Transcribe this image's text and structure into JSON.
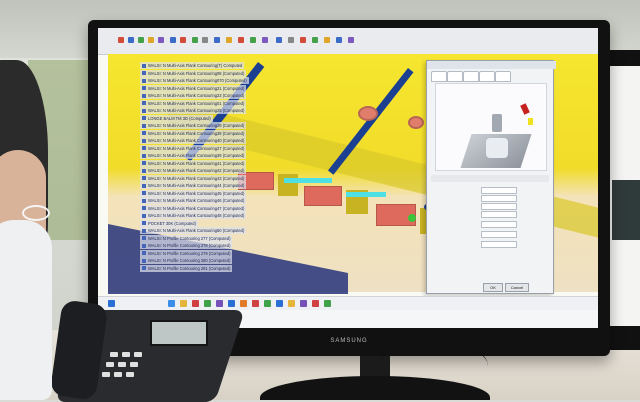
{
  "monitor": {
    "brand_label": "SAMSUNG"
  },
  "phone": {
    "brand_label": ""
  },
  "cad": {
    "menubar_text": "",
    "tree_rows": [
      "WALSI: N Multi-Axis Flank Contouring(T) Computed",
      "WALSI: N Multi-Axis Flank Contouring08 (Computed)",
      "WALSI: N Multi-Axis Flank Contouring070 (Computed)",
      "WALSI: N Multi-Axis Flank Contouring21 (Computed)",
      "WALSI: N Multi-Axis Flank Contouring23 (Computed)",
      "WALSI: N Multi-Axis Flank Contouring01 (Computed)",
      "WALSI: N Multi-Axis Flank Contouring25 (Computed)",
      "LONGE BALM TM 3D (Computed)",
      "WALSI: N Multi-Axis Flank Contouring28 (Computed)",
      "WALSI: N Multi-Axis Flank Contouring38 (Computed)",
      "WALSI: N Multi-Axis Flank Contouring40 (Computed)",
      "WALSI: N Multi-Axis Flank Contouring27 (Computed)",
      "WALSI: N Multi-Axis Flank Contouring39 (Computed)",
      "WALSI: N Multi-Axis Flank Contouring41 (Computed)",
      "WALSI: N Multi-Axis Flank Contouring42 (Computed)",
      "WALSI: N Multi-Axis Flank Contouring43 (Computed)",
      "WALSI: N Multi-Axis Flank Contouring44 (Computed)",
      "WALSI: N Multi-Axis Flank Contouring45 (Computed)",
      "WALSI: N Multi-Axis Flank Contouring46 (Computed)",
      "WALSI: N Multi-Axis Flank Contouring47 (Computed)",
      "WALSI: N Multi-Axis Flank Contouring48 (Computed)",
      "POCKET 30K (Computed)",
      "WALSI: N Multi-Axis Flank Contouring50 (Computed)",
      "WALSI: N Profile Contouring 277 (Computed)",
      "WALSI: N Profile Contouring 278 (Computed)",
      "WALSI: N Profile Contouring 279 (Computed)",
      "WALSI: N Profile Contouring 280 (Computed)",
      "WALSI: N Profile Contouring 281 (Computed)"
    ],
    "dialog": {
      "title": "",
      "param_labels": [
        "",
        "",
        "",
        "",
        "",
        "",
        ""
      ],
      "buttons": [
        "OK",
        "Cancel"
      ]
    }
  },
  "colors": {
    "part_yellow": "#f4e22e",
    "groove_blue": "#1b3f91",
    "pocket_red": "#dd6a5d",
    "cyan_highlight": "#4fe0e6",
    "tree_blue": "#4465b8"
  }
}
